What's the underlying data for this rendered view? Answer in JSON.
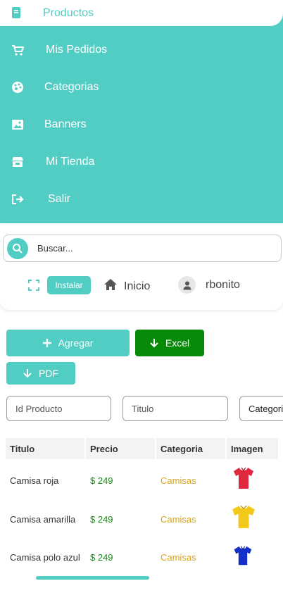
{
  "nav": {
    "active": {
      "label": "Productos",
      "icon": "book-icon"
    },
    "items": [
      {
        "label": "Mis Pedidos",
        "icon": "cart-icon"
      },
      {
        "label": "Categorias",
        "icon": "palette-icon"
      },
      {
        "label": "Banners",
        "icon": "image-icon"
      },
      {
        "label": "Mi Tienda",
        "icon": "store-icon"
      },
      {
        "label": "Salir",
        "icon": "logout-icon"
      }
    ]
  },
  "header": {
    "search": {
      "placeholder": "Buscar...",
      "value": ""
    },
    "install_label": "Instalar",
    "home_label": "Inicio",
    "username": "rbonito"
  },
  "actions": {
    "add_label": "Agregar",
    "excel_label": "Excel",
    "pdf_label": "PDF"
  },
  "filters": {
    "id_placeholder": "Id Producto",
    "title_placeholder": "Titulo",
    "category_value": "Categoria"
  },
  "table": {
    "columns": [
      "Titulo",
      "Precio",
      "Categoria",
      "Imagen"
    ],
    "rows": [
      {
        "title": "Camisa roja",
        "price": "$ 249",
        "category": "Camisas",
        "image": "red-shirt-icon",
        "color": "#e0283f"
      },
      {
        "title": "Camisa amarilla",
        "price": "$ 249",
        "category": "Camisas",
        "image": "yellow-shirt-icon",
        "color": "#f2c81a"
      },
      {
        "title": "Camisa polo azul",
        "price": "$ 249",
        "category": "Camisas",
        "image": "blue-shirt-icon",
        "color": "#1530c8"
      }
    ]
  },
  "colors": {
    "accent": "#52cdc3",
    "excel": "#078a07",
    "price": "#1a8a1a",
    "category": "#d9a31a"
  }
}
